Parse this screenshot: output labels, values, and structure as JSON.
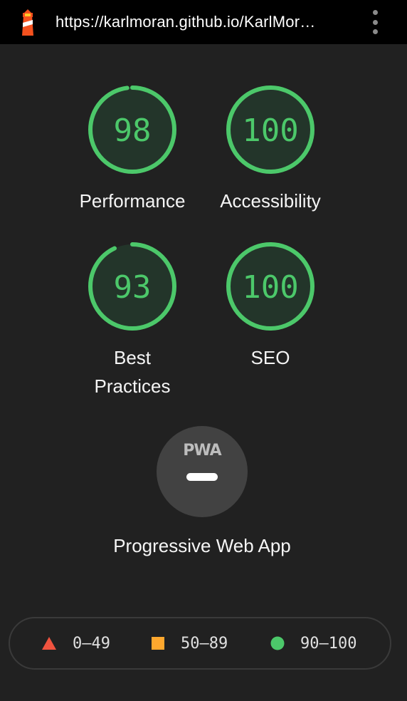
{
  "browser": {
    "url": "https://karlmoran.github.io/KarlMor…",
    "menu_icon": "more-vert-icon",
    "logo_icon": "lighthouse-icon"
  },
  "colors": {
    "pass": "#4cc86a",
    "average": "#ffa82e",
    "fail": "#f0533f",
    "gauge_fill": "#23352a",
    "page_bg": "#212121"
  },
  "gauges": [
    {
      "id": "performance",
      "score": "98",
      "label": "Performance",
      "fraction": 0.98
    },
    {
      "id": "accessibility",
      "score": "100",
      "label": "Accessibility",
      "fraction": 1.0
    },
    {
      "id": "best-practices",
      "score": "93",
      "label": "Best Practices",
      "fraction": 0.93
    },
    {
      "id": "seo",
      "score": "100",
      "label": "SEO",
      "fraction": 1.0
    }
  ],
  "pwa": {
    "badge_text": "PWA",
    "label": "Progressive Web App"
  },
  "legend": {
    "items": [
      {
        "shape": "triangle",
        "range": "0–49"
      },
      {
        "shape": "square",
        "range": "50–89"
      },
      {
        "shape": "circle",
        "range": "90–100"
      }
    ]
  }
}
